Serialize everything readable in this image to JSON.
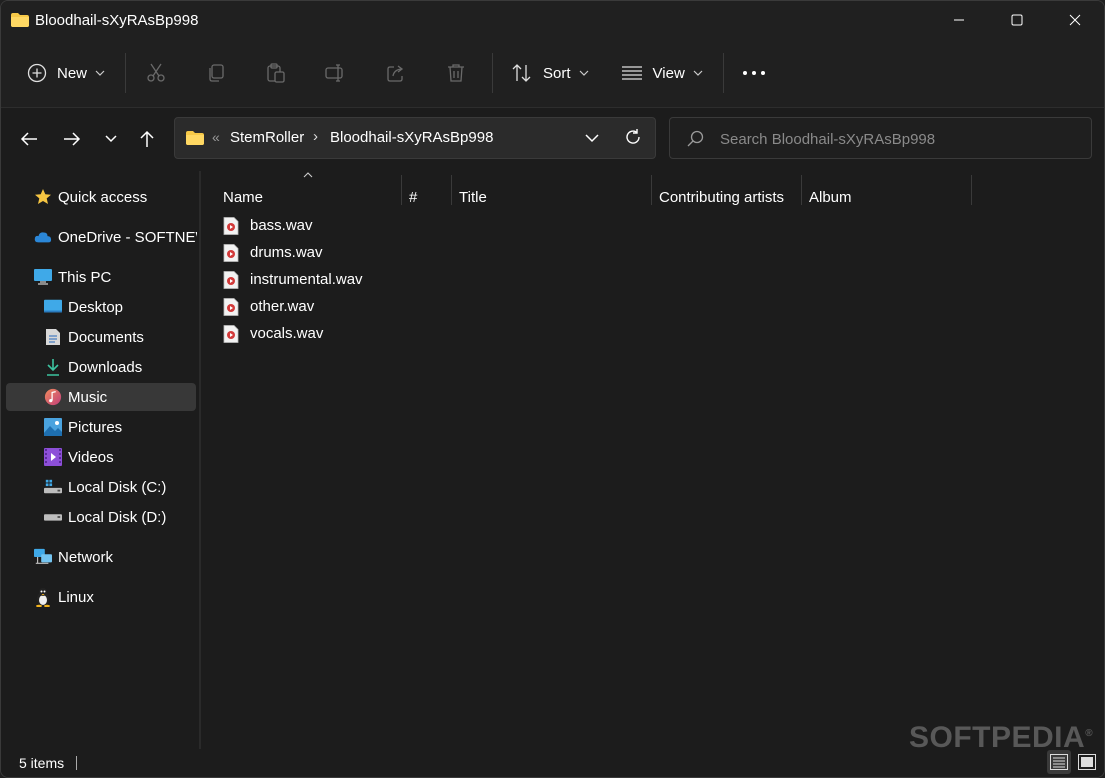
{
  "window": {
    "title": "Bloodhail-sXyRAsBp998",
    "controls": [
      "minimize-icon",
      "maximize-icon",
      "close-icon"
    ]
  },
  "commandbar": {
    "new_label": "New",
    "sort_label": "Sort",
    "view_label": "View",
    "icons": [
      "cut-icon",
      "copy-icon",
      "paste-icon",
      "rename-icon",
      "share-icon",
      "delete-icon",
      "more-icon"
    ]
  },
  "address": {
    "overflow": "«",
    "crumbs": [
      "StemRoller",
      "Bloodhail-sXyRAsBp998"
    ]
  },
  "search": {
    "placeholder": "Search Bloodhail-sXyRAsBp998"
  },
  "sidebar": {
    "items": [
      {
        "label": "Quick access",
        "icon": "star-icon"
      },
      {
        "label": "OneDrive - SOFTNEWS",
        "icon": "cloud-icon"
      },
      {
        "label": "This PC",
        "icon": "monitor-icon"
      },
      {
        "label": "Desktop",
        "icon": "desktop-icon"
      },
      {
        "label": "Documents",
        "icon": "document-icon"
      },
      {
        "label": "Downloads",
        "icon": "download-icon"
      },
      {
        "label": "Music",
        "icon": "music-icon",
        "selected": true
      },
      {
        "label": "Pictures",
        "icon": "pictures-icon"
      },
      {
        "label": "Videos",
        "icon": "videos-icon"
      },
      {
        "label": "Local Disk (C:)",
        "icon": "drive-icon"
      },
      {
        "label": "Local Disk (D:)",
        "icon": "drive-icon"
      },
      {
        "label": "Network",
        "icon": "network-icon"
      },
      {
        "label": "Linux",
        "icon": "linux-icon"
      }
    ]
  },
  "columns": [
    "Name",
    "#",
    "Title",
    "Contributing artists",
    "Album"
  ],
  "files": [
    {
      "name": "bass.wav",
      "icon": "audio-file-icon"
    },
    {
      "name": "drums.wav",
      "icon": "audio-file-icon"
    },
    {
      "name": "instrumental.wav",
      "icon": "audio-file-icon"
    },
    {
      "name": "other.wav",
      "icon": "audio-file-icon"
    },
    {
      "name": "vocals.wav",
      "icon": "audio-file-icon"
    }
  ],
  "status": {
    "count": "5 items"
  },
  "watermark": "SOFTPEDIA",
  "colors": {
    "folder": "#f7c948",
    "accent": "#4aa3df",
    "background": "#1c1c1c"
  }
}
